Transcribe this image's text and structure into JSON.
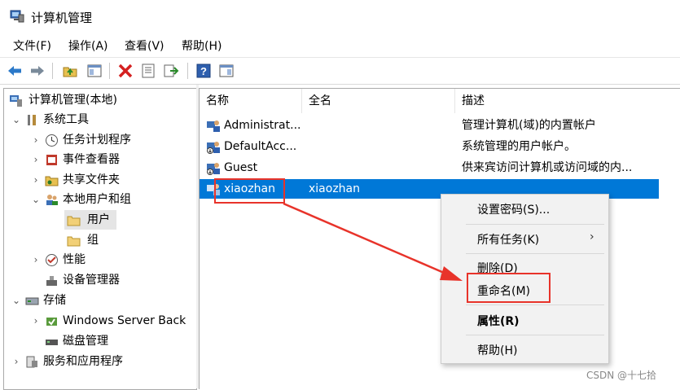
{
  "window": {
    "title": "计算机管理"
  },
  "menu": [
    "文件(F)",
    "操作(A)",
    "查看(V)",
    "帮助(H)"
  ],
  "toolbar": [
    "back-arrow-icon",
    "forward-arrow-icon",
    "up-folder-icon",
    "show-hide-tree-icon",
    "delete-icon",
    "properties-icon",
    "export-icon",
    "help-icon",
    "view-icon"
  ],
  "tree": {
    "root": "计算机管理(本地)",
    "system_tools": "系统工具",
    "task_scheduler": "任务计划程序",
    "event_viewer": "事件查看器",
    "shared_folders": "共享文件夹",
    "local_users_groups": "本地用户和组",
    "users": "用户",
    "groups": "组",
    "performance": "性能",
    "device_manager": "设备管理器",
    "storage": "存储",
    "windows_server_backup": "Windows Server Back",
    "disk_management": "磁盘管理",
    "services_apps": "服务和应用程序"
  },
  "columns": {
    "name": "名称",
    "fullname": "全名",
    "description": "描述"
  },
  "users": [
    {
      "name": "Administrat...",
      "fullname": "",
      "description": "管理计算机(域)的内置帐户"
    },
    {
      "name": "DefaultAcc...",
      "fullname": "",
      "description": "系统管理的用户帐户。"
    },
    {
      "name": "Guest",
      "fullname": "",
      "description": "供来宾访问计算机或访问域的内..."
    },
    {
      "name": "xiaozhan",
      "fullname": "xiaozhan",
      "description": ""
    }
  ],
  "context_menu": {
    "set_password": "设置密码(S)...",
    "all_tasks": "所有任务(K)",
    "all_tasks_arrow": "›",
    "delete": "删除(D)",
    "rename": "重命名(M)",
    "properties": "属性(R)",
    "help": "帮助(H)"
  },
  "watermark": "CSDN @十七拾",
  "colors": {
    "selection": "#0078d7",
    "annotation": "#e8332a"
  }
}
